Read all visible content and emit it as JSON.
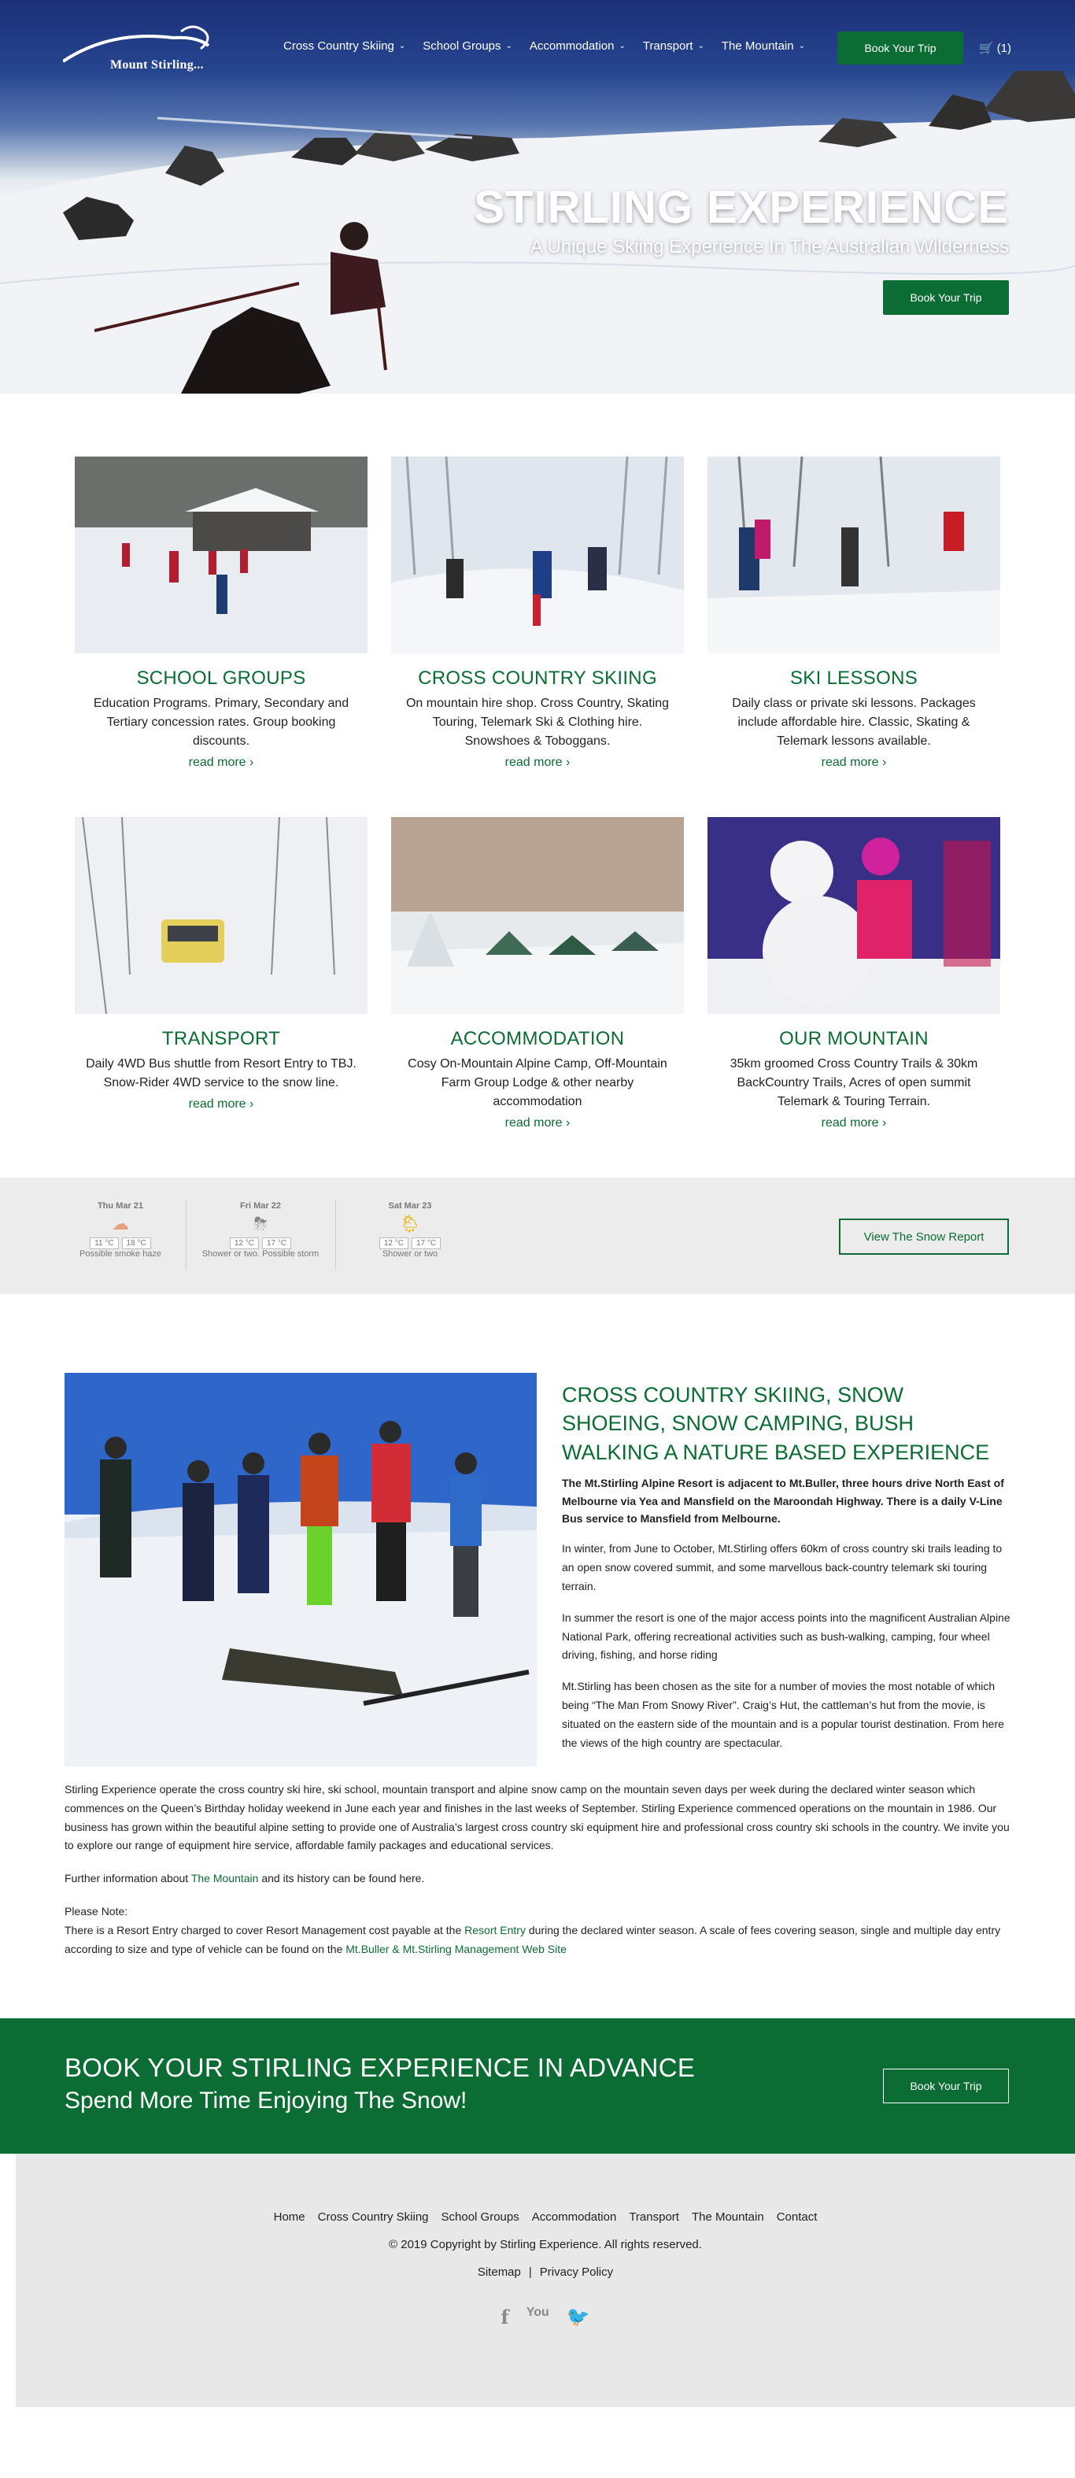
{
  "brand": {
    "name": "Mount Stirling..."
  },
  "nav": {
    "items": [
      {
        "label": "Cross Country Skiing"
      },
      {
        "label": "School Groups"
      },
      {
        "label": "Accommodation"
      },
      {
        "label": "Transport"
      },
      {
        "label": "The Mountain"
      }
    ],
    "book_label": "Book Your Trip",
    "cart_label": "(1)"
  },
  "hero": {
    "title": "STIRLING EXPERIENCE",
    "subtitle": "A Unique Skiing Experience In The Australian Wilderness",
    "book_label": "Book Your Trip"
  },
  "cards": [
    {
      "title": "SCHOOL GROUPS",
      "text": "Education Programs. Primary, Secondary and Tertiary concession rates. Group booking discounts.",
      "more": "read more ›"
    },
    {
      "title": "CROSS COUNTRY SKIING",
      "text": "On mountain hire shop. Cross Country, Skating Touring, Telemark Ski & Clothing hire. Snowshoes & Toboggans.",
      "more": "read more ›"
    },
    {
      "title": "SKI LESSONS",
      "text": "Daily class or private ski lessons. Packages include affordable hire. Classic, Skating & Telemark lessons available.",
      "more": "read more ›"
    },
    {
      "title": "TRANSPORT",
      "text": "Daily 4WD Bus shuttle from Resort Entry to TBJ. Snow-Rider 4WD service to the snow line.",
      "more": "read more ›"
    },
    {
      "title": "ACCOMMODATION",
      "text": "Cosy On-Mountain Alpine Camp, Off-Mountain Farm Group Lodge & other nearby accommodation",
      "more": "read more ›"
    },
    {
      "title": "OUR MOUNTAIN",
      "text": "35km groomed Cross Country Trails & 30km BackCountry Trails, Acres of open summit Telemark & Touring Terrain.",
      "more": "read more ›"
    }
  ],
  "weather": {
    "days": [
      {
        "day": "Thu Mar 21",
        "icon": "haze-icon",
        "glyph": "☁",
        "low": "11 °C",
        "high": "18 °C",
        "desc": "Possible smoke haze"
      },
      {
        "day": "Fri Mar 22",
        "icon": "storm-icon",
        "glyph": "⛈",
        "low": "12 °C",
        "high": "17 °C",
        "desc": "Shower or two. Possible storm"
      },
      {
        "day": "Sat Mar 23",
        "icon": "sun-shower-icon",
        "glyph": "🌦",
        "low": "12 °C",
        "high": "17 °C",
        "desc": "Shower or two"
      }
    ],
    "button_label": "View The Snow Report"
  },
  "about": {
    "heading": "CROSS COUNTRY SKIING, SNOW SHOEING, SNOW CAMPING, BUSH WALKING A NATURE BASED EXPERIENCE",
    "intro": "The Mt.Stirling Alpine Resort is adjacent to Mt.Buller, three hours drive North East of Melbourne via Yea and Mansfield on the Maroondah Highway. There is a daily V-Line Bus service to Mansfield from Melbourne.",
    "p1": "In winter, from June to October, Mt.Stirling offers 60km of cross country ski trails leading to an open snow covered summit, and some marvellous back-country telemark ski touring terrain.",
    "p2": "In summer the resort is one of the major access points into the magnificent Australian Alpine National Park, offering recreational activities such as bush-walking, camping, four wheel driving, fishing, and horse riding",
    "p3": "Mt.Stirling has been chosen as the site for a number of movies the most notable of which being “The Man From Snowy River”. Craig’s Hut, the cattleman’s hut from the movie, is situated on the eastern side of the mountain and is a popular tourist destination. From here the views of the high country are spectacular.",
    "p4": "Stirling Experience operate the cross country ski hire, ski school, mountain transport and alpine snow camp on the mountain seven days per week during the declared winter season which commences on the Queen’s Birthday holiday weekend in June each year and finishes in the last weeks of September. Stirling Experience commenced operations on the mountain in 1986. Our business has grown within the beautiful alpine setting to provide one of Australia’s largest cross country ski equipment hire and professional cross country ski schools in the country. We invite you to explore our range of equipment  hire service, affordable family packages and educational services.",
    "further_pre": "Further information about ",
    "further_link": "The Mountain",
    "further_post": " and its history can be found here.",
    "note_label": "Please Note:",
    "note_pre": "There is a Resort Entry charged to cover Resort Management cost payable at the ",
    "note_link1": "Resort Entry",
    "note_mid": " during the declared winter season. A scale of fees covering season, single and multiple day entry according to size and type of vehicle can be found on the ",
    "note_link2": "Mt.Buller & Mt.Stirling Management Web Site"
  },
  "cta": {
    "title": "BOOK YOUR STIRLING EXPERIENCE IN ADVANCE",
    "subtitle": "Spend More Time Enjoying The Snow!",
    "button_label": "Book Your Trip"
  },
  "footer": {
    "nav": [
      "Home",
      "Cross Country Skiing",
      "School Groups",
      "Accommodation",
      "Transport",
      "The Mountain",
      "Contact"
    ],
    "copyright": "© 2019 Copyright by Stirling Experience. All rights reserved.",
    "sitemap": "Sitemap",
    "separator": "|",
    "privacy": "Privacy Policy",
    "social": [
      {
        "icon": "facebook-icon",
        "glyph": "f"
      },
      {
        "icon": "youtube-icon",
        "glyph": "You"
      },
      {
        "icon": "twitter-icon",
        "glyph": "🐦"
      }
    ]
  },
  "colors": {
    "brand_green": "#0b6d34",
    "hero_sky": "#1b2f78",
    "weather_bg": "#ececec",
    "footer_bg": "#e8e8e8"
  }
}
